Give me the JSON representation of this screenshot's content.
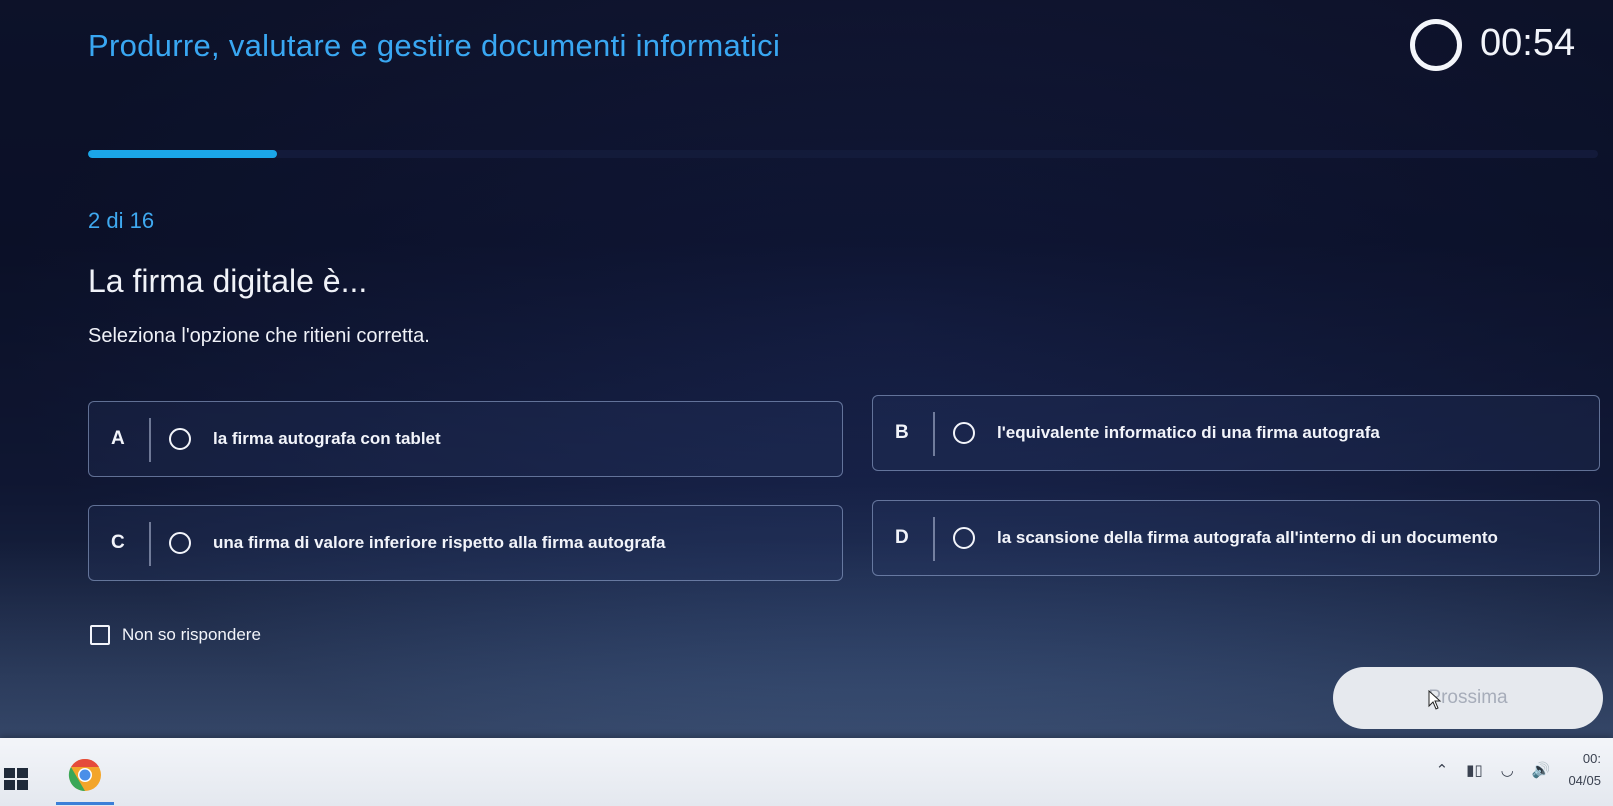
{
  "header": {
    "title": "Produrre, valutare e gestire documenti informatici",
    "timer": "00:54"
  },
  "progress": {
    "current": 2,
    "total": 16,
    "fraction": 0.125,
    "label": "2 di 16"
  },
  "question": {
    "text": "La firma digitale è...",
    "instruction": "Seleziona l'opzione che ritieni corretta."
  },
  "options": [
    {
      "letter": "A",
      "text": "la firma autografa con tablet"
    },
    {
      "letter": "B",
      "text": "l'equivalente informatico di una firma autografa"
    },
    {
      "letter": "C",
      "text": "una firma di valore inferiore rispetto alla firma autografa"
    },
    {
      "letter": "D",
      "text": "la scansione della firma autografa all'interno di un documento"
    }
  ],
  "dont_know": {
    "label": "Non so rispondere",
    "checked": false
  },
  "next_button": {
    "label": "Prossima"
  },
  "taskbar": {
    "clock_time": "00:",
    "clock_date": "04/05",
    "tray_icons": [
      "chevron-up-icon",
      "battery-icon",
      "wifi-icon",
      "volume-icon"
    ],
    "apps": [
      "windows-start-icon",
      "chrome-icon"
    ]
  },
  "colors": {
    "accent": "#1ba6e8",
    "title": "#39a7f2",
    "background_dark": "#0f1635"
  }
}
